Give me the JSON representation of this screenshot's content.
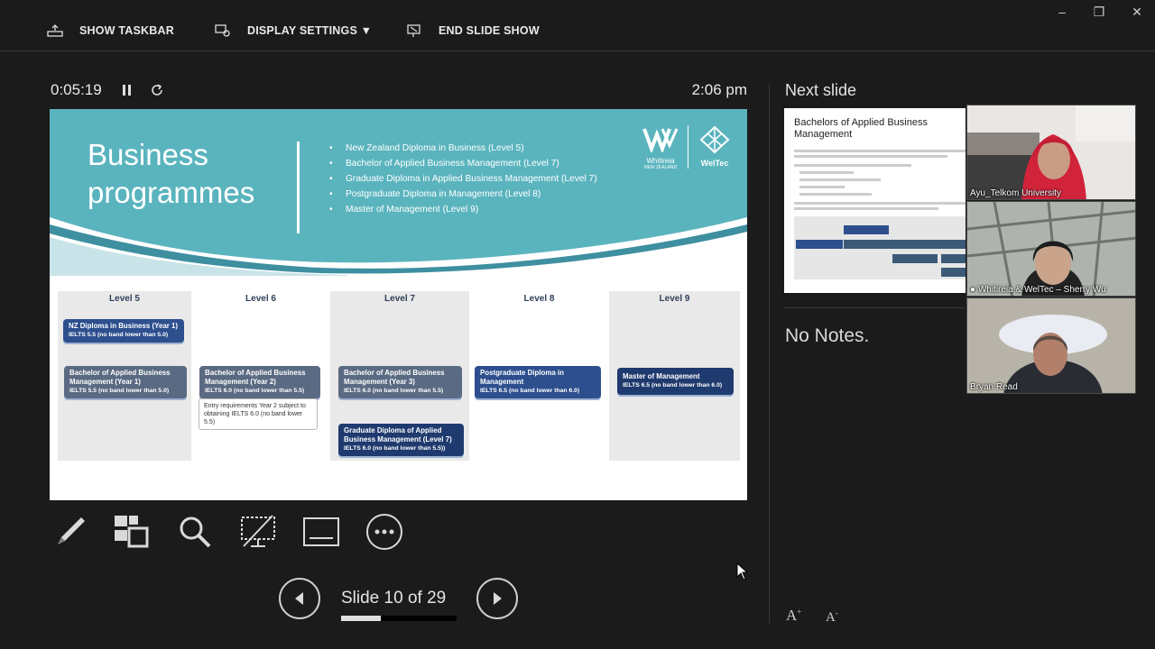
{
  "window": {
    "minimize_glyph": "–",
    "restore_glyph": "❐",
    "close_glyph": "✕"
  },
  "toolbar": {
    "show_taskbar": "SHOW TASKBAR",
    "display_settings": "DISPLAY SETTINGS ▼",
    "end_slide_show": "END SLIDE SHOW"
  },
  "timer": {
    "elapsed": "0:05:19",
    "clock": "2:06 pm"
  },
  "slide": {
    "title_line1": "Business",
    "title_line2": "programmes",
    "bullets": [
      "New Zealand Diploma in Business (Level 5)",
      "Bachelor of Applied Business Management (Level 7)",
      "Graduate Diploma in Applied Business Management (Level 7)",
      "Postgraduate Diploma in Management (Level 8)",
      "Master of Management  (Level 9)"
    ],
    "logo1_name": "Whitireia",
    "logo1_sub": "NEW ZEALAND",
    "logo2_name": "WelTec",
    "levels": [
      "Level 5",
      "Level 6",
      "Level 7",
      "Level 8",
      "Level 9"
    ],
    "boxes": {
      "nz_diploma_title": "NZ Diploma in Business (Year 1)",
      "nz_diploma_sub": "IELTS 5.5 (no band lower than 5.0)",
      "b1_title": "Bachelor of Applied Business Management (Year 1)",
      "b1_sub": "IELTS 5.5 (no band lower than 5.0)",
      "b2_title": "Bachelor of Applied Business Management (Year 2)",
      "b2_sub": "IELTS 6.0 (no band lower than 5.5)",
      "b2_note": "Entry requirements Year 2 subject to obtaining IELTS 6.0 (no band lower 5.5)",
      "b3_title": "Bachelor of Applied Business Management (Year 3)",
      "b3_sub": "IELTS 6.0 (no band lower than 5.5)",
      "grad_title": "Graduate Diploma of Applied Business Management (Level 7)",
      "grad_sub": "IELTS 6.0 (no band lower than 5.5))",
      "pg_title": "Postgraduate Diploma in Management",
      "pg_sub": "IELTS 6.5 (no band lower than 6.0)",
      "master_title": "Master of Management",
      "master_sub": "IELTS 6.5 (no band lower than 6.0)"
    }
  },
  "navigation": {
    "slide_counter": "Slide 10 of 29",
    "progress_fraction": 0.345
  },
  "next_slide": {
    "label": "Next slide",
    "thumb_title": "Bachelors of Applied Business Management"
  },
  "notes": {
    "text": "No Notes."
  },
  "participants": [
    {
      "name": "Ayu_Telkom University",
      "bg": "#7a2a32"
    },
    {
      "name": "● Whitireia & WelTec – Sherry Wu",
      "bg": "#5b6258"
    },
    {
      "name": "Bryan Read",
      "bg": "#9a9589"
    }
  ],
  "colors": {
    "teal": "#5ab4be",
    "navy": "#2d4f8e",
    "bg": "#1b1b1b"
  }
}
